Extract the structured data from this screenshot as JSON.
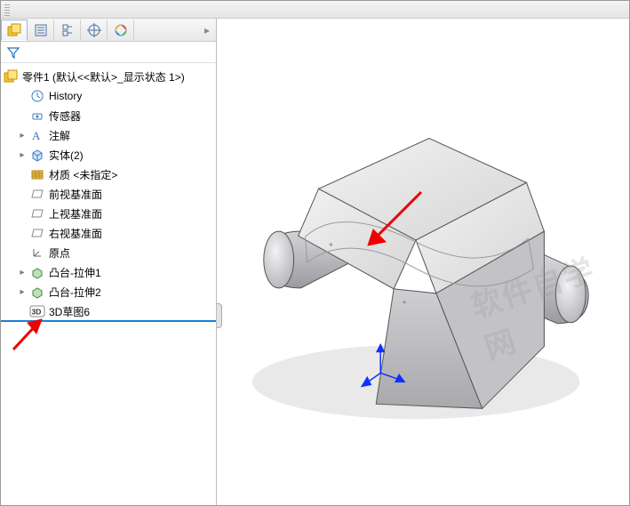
{
  "tree": {
    "root_label": "零件1  (默认<<默认>_显示状态 1>)",
    "items": [
      {
        "label": "History",
        "icon": "history"
      },
      {
        "label": "传感器",
        "icon": "sensor"
      },
      {
        "label": "注解",
        "icon": "annotation",
        "expandable": true
      },
      {
        "label": "实体(2)",
        "icon": "solid",
        "expandable": true
      },
      {
        "label": "材质 <未指定>",
        "icon": "material"
      },
      {
        "label": "前视基准面",
        "icon": "plane"
      },
      {
        "label": "上视基准面",
        "icon": "plane"
      },
      {
        "label": "右视基准面",
        "icon": "plane"
      },
      {
        "label": "原点",
        "icon": "origin"
      },
      {
        "label": "凸台-拉伸1",
        "icon": "extrude",
        "expandable": true
      },
      {
        "label": "凸台-拉伸2",
        "icon": "extrude",
        "expandable": true
      },
      {
        "label": "3D草图6",
        "icon": "sketch3d",
        "selected": true
      }
    ]
  },
  "tabs": {
    "aria_labels": [
      "feature-manager",
      "property-manager",
      "configuration-manager",
      "dimxpert-manager",
      "display-manager"
    ]
  },
  "watermark": "软件自学网"
}
